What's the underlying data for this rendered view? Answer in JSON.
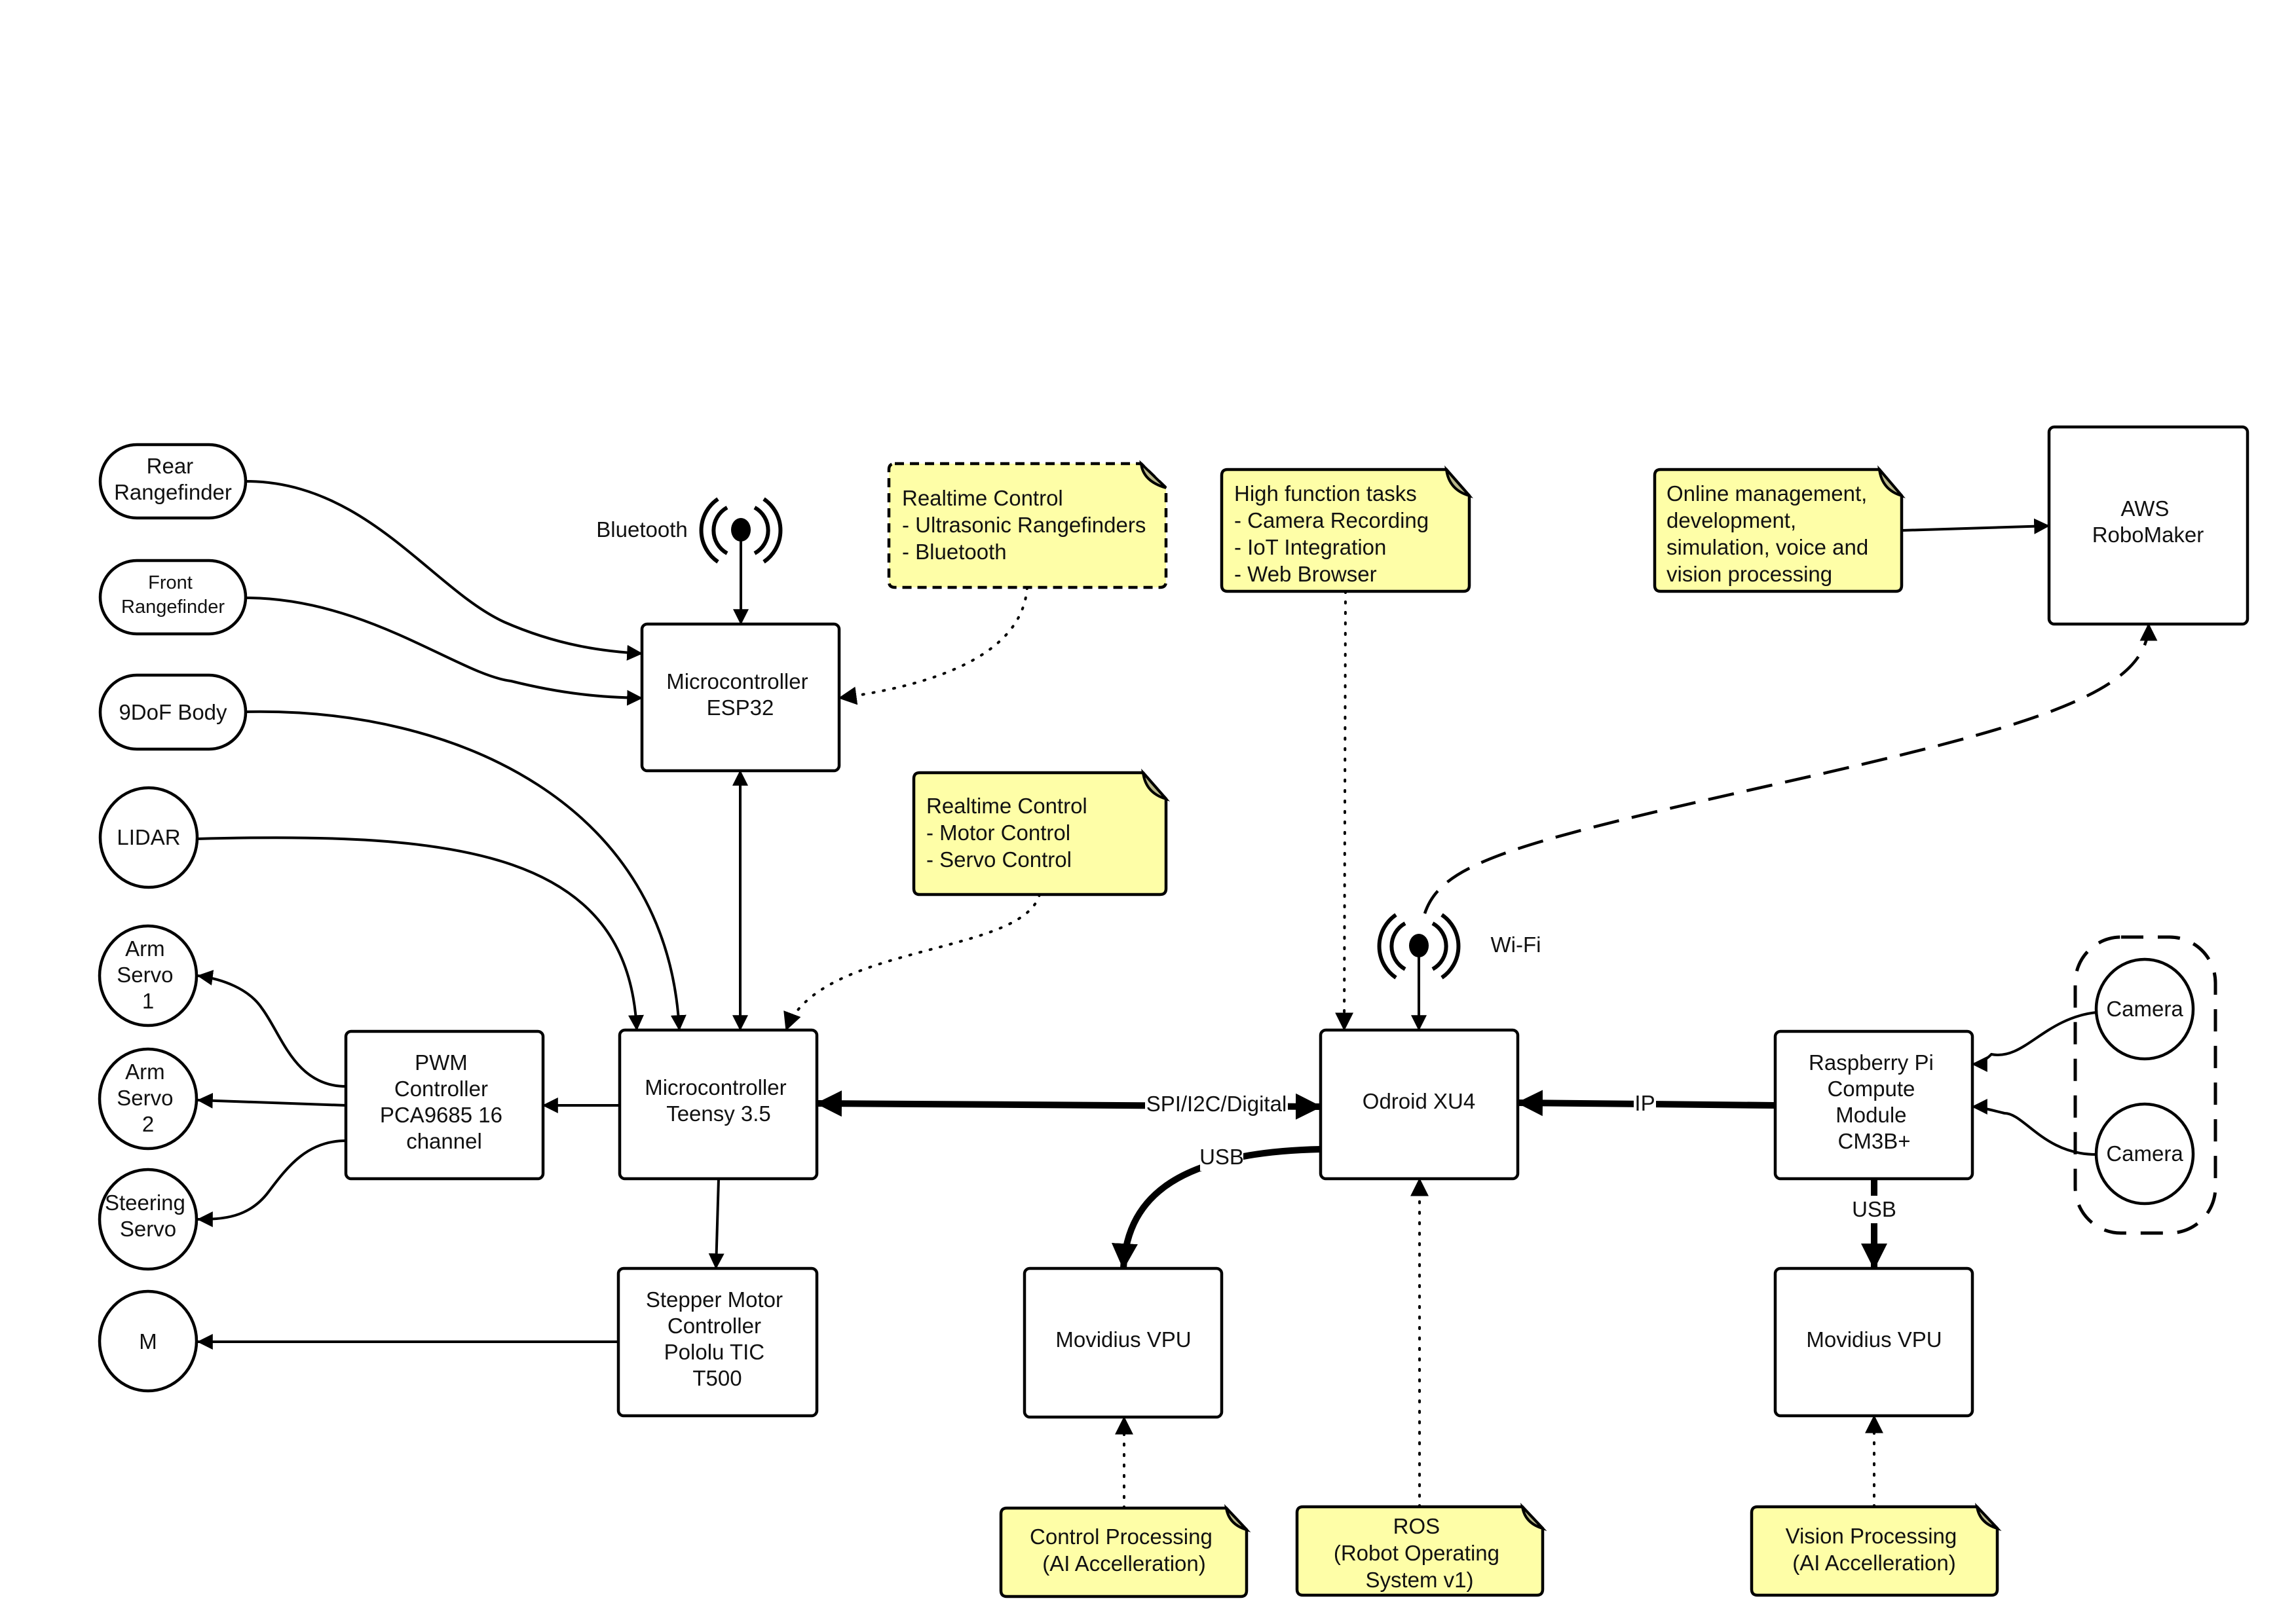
{
  "colors": {
    "note_fill": "#fefea7",
    "note_fold": "#b9b88a",
    "stroke": "#000000",
    "background": "#ffffff"
  },
  "nodes": {
    "rear_rangefinder": {
      "lines": [
        "Rear",
        "Rangefinder"
      ]
    },
    "front_rangefinder": {
      "lines": [
        "Front",
        "Rangefinder"
      ]
    },
    "ninedof_body": {
      "lines": [
        "9DoF Body"
      ]
    },
    "lidar": {
      "lines": [
        "LIDAR"
      ]
    },
    "arm_servo_1": {
      "lines": [
        "Arm",
        "Servo",
        "1"
      ]
    },
    "arm_servo_2": {
      "lines": [
        "Arm",
        "Servo",
        "2"
      ]
    },
    "steering_servo": {
      "lines": [
        "Steering",
        "Servo"
      ]
    },
    "motor": {
      "lines": [
        "M"
      ]
    },
    "esp32": {
      "lines": [
        "Microcontroller",
        "ESP32"
      ]
    },
    "pwm": {
      "lines": [
        "PWM",
        "Controller",
        "PCA9685 16",
        "channel"
      ]
    },
    "teensy": {
      "lines": [
        "Microcontroller",
        "Teensy 3.5"
      ]
    },
    "stepper": {
      "lines": [
        "Stepper Motor",
        "Controller",
        "Pololu TIC",
        "T500"
      ]
    },
    "odroid": {
      "lines": [
        "Odroid XU4"
      ]
    },
    "rpi": {
      "lines": [
        "Raspberry Pi",
        "Compute",
        "Module",
        "CM3B+"
      ]
    },
    "movidius_1": {
      "lines": [
        "Movidius VPU"
      ]
    },
    "movidius_2": {
      "lines": [
        "Movidius VPU"
      ]
    },
    "camera_1": {
      "lines": [
        "Camera"
      ]
    },
    "camera_2": {
      "lines": [
        "Camera"
      ]
    },
    "aws": {
      "lines": [
        "AWS",
        "RoboMaker"
      ]
    }
  },
  "antennas": {
    "bluetooth": {
      "label": "Bluetooth",
      "icon": "antenna-icon"
    },
    "wifi": {
      "label": "Wi-Fi",
      "icon": "antenna-icon"
    }
  },
  "notes": {
    "realtime_sensors": {
      "lines": [
        "Realtime Control",
        "- Ultrasonic Rangefinders",
        "- Bluetooth"
      ]
    },
    "high_function": {
      "lines": [
        "High function tasks",
        "- Camera Recording",
        "- IoT Integration",
        "- Web Browser"
      ]
    },
    "online": {
      "lines": [
        "Online management,",
        "development,",
        "simulation, voice and",
        "vision processing"
      ]
    },
    "realtime_motor": {
      "lines": [
        "Realtime Control",
        "- Motor Control",
        "- Servo Control"
      ]
    },
    "control_processing": {
      "lines": [
        "Control Processing",
        "(AI Accelleration)"
      ]
    },
    "ros": {
      "lines": [
        "ROS",
        "(Robot Operating",
        "System v1)"
      ]
    },
    "vision_processing": {
      "lines": [
        "Vision Processing",
        "(AI Accelleration)"
      ]
    }
  },
  "edge_labels": {
    "spi": "SPI/I2C/Digital",
    "usb_odroid": "USB",
    "ip": "IP",
    "usb_rpi": "USB"
  }
}
